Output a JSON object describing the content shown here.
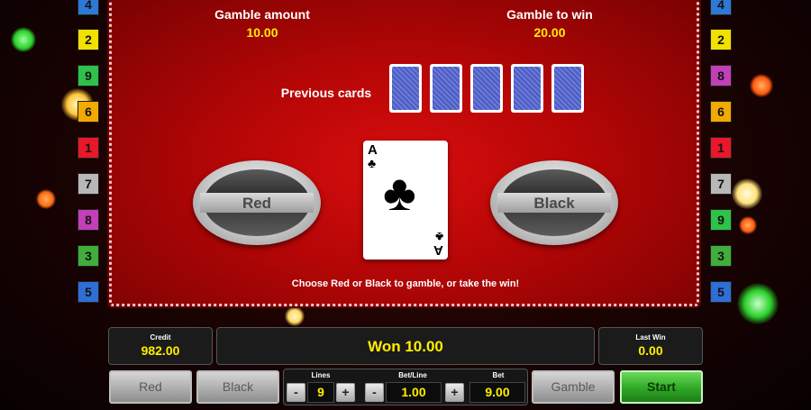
{
  "left_lines": [
    {
      "n": "4",
      "color": "#2e78d6"
    },
    {
      "n": "2",
      "color": "#f2e000"
    },
    {
      "n": "9",
      "color": "#2ec24a"
    },
    {
      "n": "6",
      "color": "#f2a900"
    },
    {
      "n": "1",
      "color": "#e8182a"
    },
    {
      "n": "7",
      "color": "#b8b8b8"
    },
    {
      "n": "8",
      "color": "#c23fb8"
    },
    {
      "n": "3",
      "color": "#3fae3a"
    },
    {
      "n": "5",
      "color": "#2e6fd6"
    }
  ],
  "right_lines": [
    {
      "n": "4",
      "color": "#2e78d6"
    },
    {
      "n": "2",
      "color": "#f2e000"
    },
    {
      "n": "8",
      "color": "#c23fb8"
    },
    {
      "n": "6",
      "color": "#f2a900"
    },
    {
      "n": "1",
      "color": "#e8182a"
    },
    {
      "n": "7",
      "color": "#b8b8b8"
    },
    {
      "n": "9",
      "color": "#2ec24a"
    },
    {
      "n": "3",
      "color": "#3fae3a"
    },
    {
      "n": "5",
      "color": "#2e6fd6"
    }
  ],
  "gamble": {
    "amount_label": "Gamble amount",
    "amount_value": "10.00",
    "to_win_label": "Gamble to win",
    "to_win_value": "20.00",
    "previous_cards_label": "Previous cards",
    "red_label": "Red",
    "black_label": "Black",
    "card_rank": "A",
    "card_suit": "♣",
    "instruction": "Choose Red or Black to gamble, or take the win!"
  },
  "status": {
    "credit_label": "Credit",
    "credit_value": "982.00",
    "message": "Won 10.00",
    "last_win_label": "Last Win",
    "last_win_value": "0.00"
  },
  "controls": {
    "red_button": "Red",
    "black_button": "Black",
    "lines_label": "Lines",
    "lines_value": "9",
    "betline_label": "Bet/Line",
    "betline_value": "1.00",
    "bet_label": "Bet",
    "bet_value": "9.00",
    "minus": "-",
    "plus": "+",
    "gamble_button": "Gamble",
    "start_button": "Start"
  },
  "colors": {
    "accent_yellow": "#ffee00",
    "start_green": "#2fa824",
    "table_red": "#c80808"
  }
}
